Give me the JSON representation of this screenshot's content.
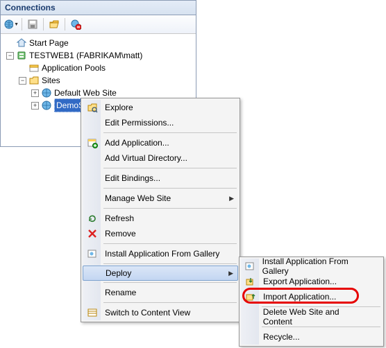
{
  "panel": {
    "title": "Connections"
  },
  "tree": {
    "start_page": "Start Page",
    "server": "TESTWEB1 (FABRIKAM\\matt)",
    "app_pools": "Application Pools",
    "sites": "Sites",
    "default_site": "Default Web Site",
    "demo_site": "DemoSite"
  },
  "menu1": {
    "explore": "Explore",
    "edit_perm": "Edit Permissions...",
    "add_app": "Add Application...",
    "add_vdir": "Add Virtual Directory...",
    "edit_bind": "Edit Bindings...",
    "manage": "Manage Web Site",
    "refresh": "Refresh",
    "remove": "Remove",
    "install_gallery": "Install Application From Gallery",
    "deploy": "Deploy",
    "rename": "Rename",
    "switch_view": "Switch to Content View"
  },
  "menu2": {
    "install_gallery": "Install Application From Gallery",
    "export_app": "Export Application...",
    "import_app": "Import Application...",
    "delete_site": "Delete Web Site and Content",
    "recycle": "Recycle..."
  }
}
